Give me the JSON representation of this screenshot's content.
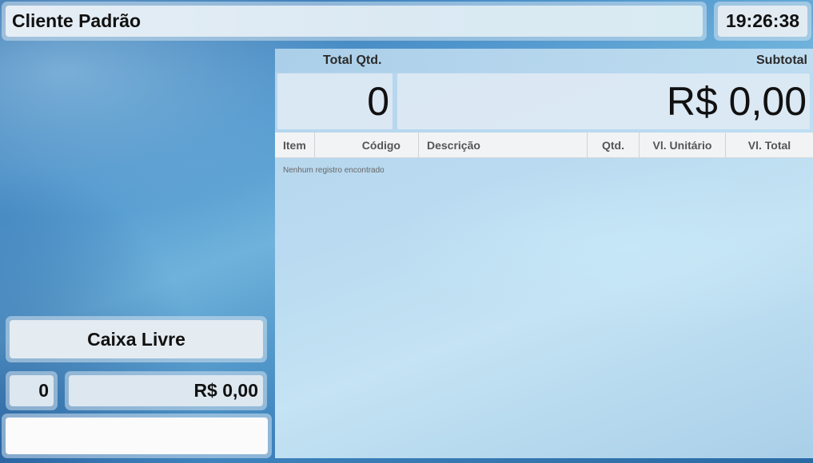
{
  "header": {
    "client_name": "Cliente Padrão",
    "clock": "19:26:38"
  },
  "totals": {
    "total_qtd_label": "Total Qtd.",
    "total_qtd_value": "0",
    "subtotal_label": "Subtotal",
    "subtotal_value": "R$ 0,00"
  },
  "grid": {
    "columns": [
      "Item",
      "Código",
      "Descrição",
      "Qtd.",
      "Vl. Unitário",
      "Vl. Total"
    ],
    "rows": [],
    "empty_message": "Nenhum registro encontrado"
  },
  "sidebar": {
    "status": "Caixa Livre",
    "count": "0",
    "amount": "R$ 0,00",
    "input_value": ""
  }
}
